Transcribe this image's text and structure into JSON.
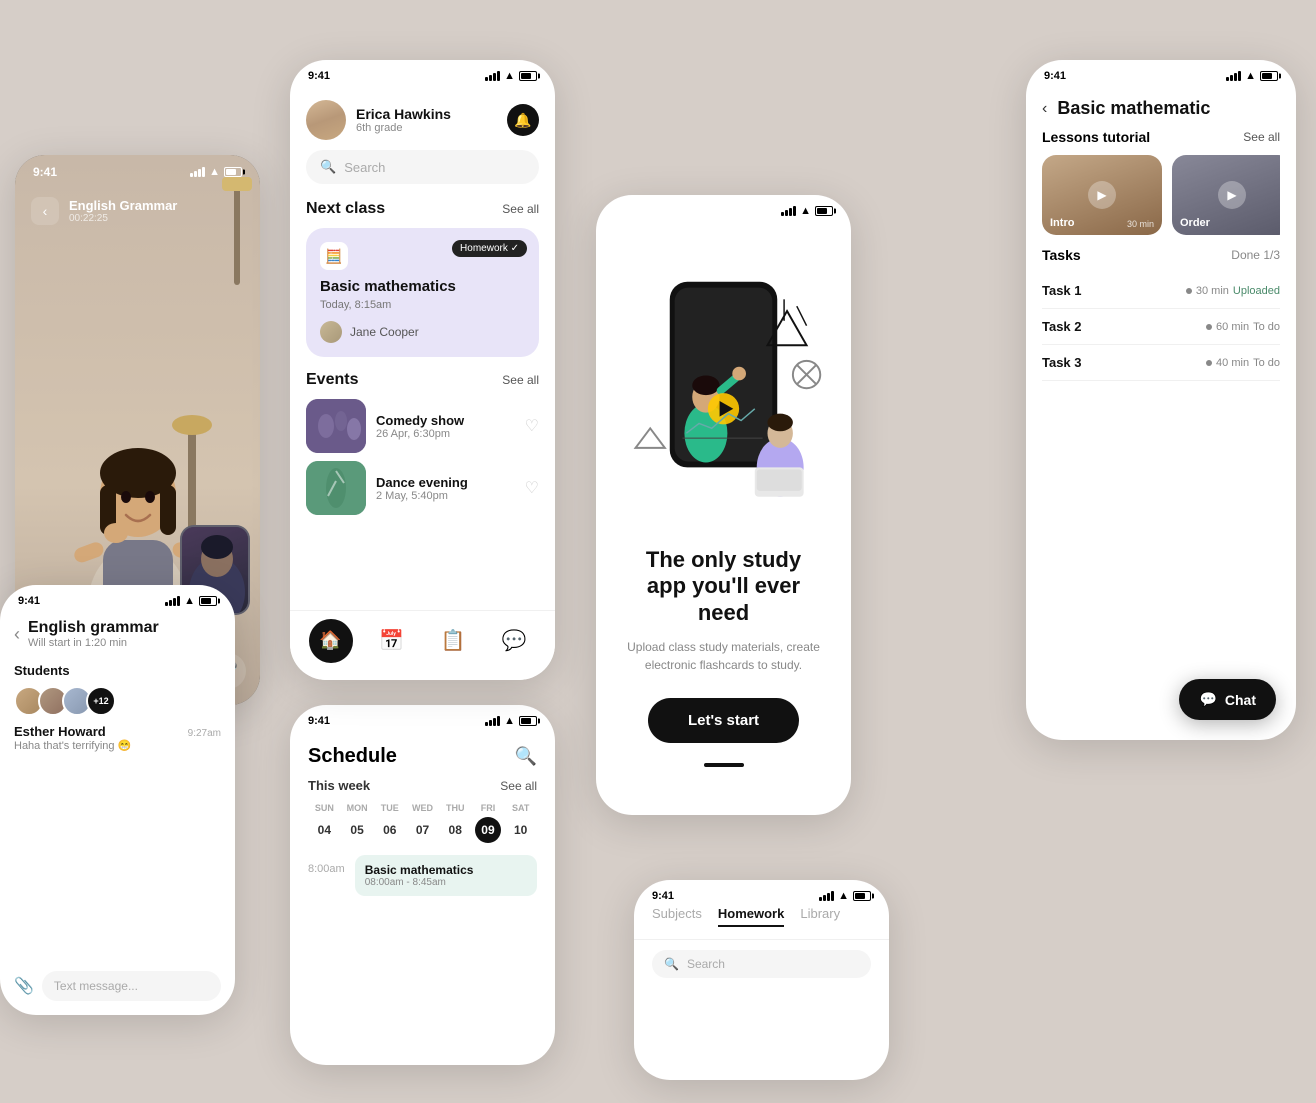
{
  "bg_color": "#d6cec8",
  "phone_video": {
    "status_time": "9:41",
    "title": "English Grammar",
    "timer": "00:22:25",
    "back": "‹"
  },
  "phone_home": {
    "status_time": "9:41",
    "user_name": "Erica Hawkins",
    "user_grade": "6th grade",
    "search_placeholder": "Search",
    "next_class_label": "Next class",
    "see_all": "See all",
    "homework_badge": "Homework ✓",
    "class_name": "Basic mathematics",
    "class_time": "Today, 8:15am",
    "teacher": "Jane Cooper",
    "events_label": "Events",
    "events_see_all": "See all",
    "event1_name": "Comedy show",
    "event1_date": "26 Apr, 6:30pm",
    "event2_name": "Dance evening",
    "event2_date": "2 May, 5:40pm"
  },
  "phone_onboard": {
    "title": "The only study app you'll  ever need",
    "desc": "Upload class study materials, create electronic flashcards to study.",
    "btn_label": "Let's start"
  },
  "phone_schedule": {
    "status_time": "9:41",
    "title": "Schedule",
    "this_week": "This week",
    "see_all": "See all",
    "days": [
      {
        "name": "SUN",
        "num": "04"
      },
      {
        "name": "MON",
        "num": "05"
      },
      {
        "name": "TUE",
        "num": "06"
      },
      {
        "name": "WED",
        "num": "07"
      },
      {
        "name": "THU",
        "num": "08"
      },
      {
        "name": "FRI",
        "num": "09",
        "active": true
      },
      {
        "name": "SAT",
        "num": "10"
      }
    ],
    "time_label": "8:00am",
    "class_name": "Basic mathematics",
    "class_time": "08:00am - 8:45am"
  },
  "phone_homework": {
    "status_time": "9:41",
    "tabs": [
      "Subjects",
      "Homework",
      "Library"
    ],
    "active_tab": "Homework",
    "search_placeholder": "Search"
  },
  "phone_chat": {
    "status_time": "9:41",
    "title": "English grammar",
    "subtitle": "Will start in 1:20 min",
    "students_label": "Students",
    "avatar_count": "+12",
    "msg_name": "Esther Howard",
    "msg_text": "Haha that's terrifying 😁",
    "msg_time": "9:27am",
    "input_placeholder": "Text message..."
  },
  "phone_detail": {
    "status_time": "9:41",
    "back": "‹",
    "title": "Basic mathematic",
    "lessons_label": "Lessons tutorial",
    "see_all": "See all",
    "lesson1_label": "Intro",
    "lesson1_duration": "30 min",
    "lesson2_label": "Order",
    "tasks_label": "Tasks",
    "tasks_done": "Done 1/3",
    "task1_name": "Task 1",
    "task1_time": "30 min",
    "task1_status": "Uploaded",
    "task2_name": "Task 2",
    "task2_time": "60 min",
    "task2_status": "To do",
    "task3_name": "Task 3",
    "task3_time": "40 min",
    "task3_status": "To do",
    "chat_btn": "Chat"
  }
}
